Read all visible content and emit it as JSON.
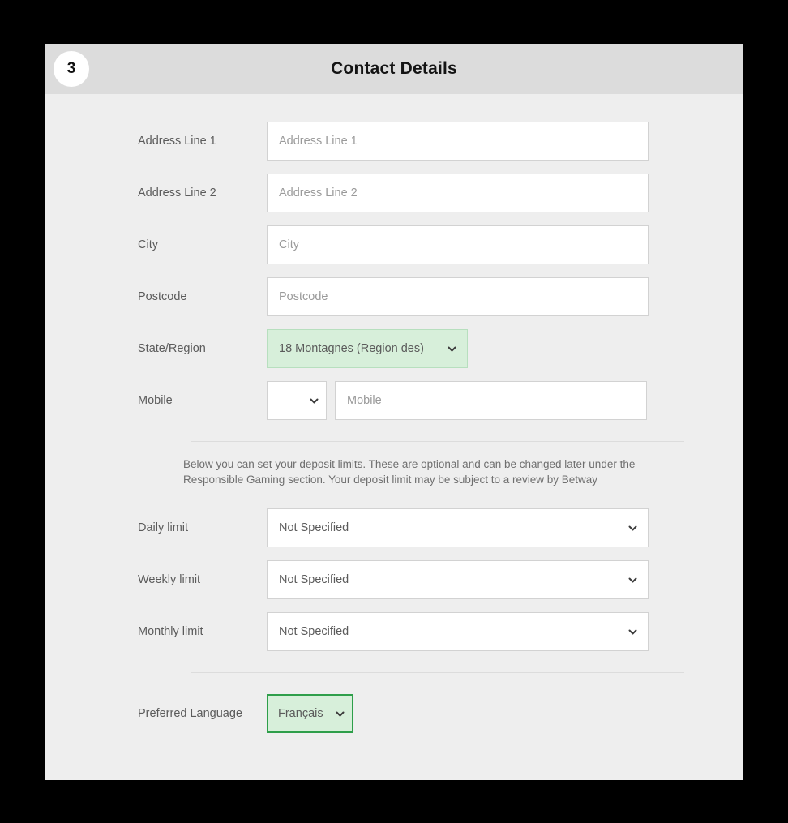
{
  "header": {
    "step_number": "3",
    "title": "Contact Details"
  },
  "form": {
    "fields": [
      {
        "label": "Address Line 1",
        "placeholder": "Address Line 1",
        "value": ""
      },
      {
        "label": "Address Line 2",
        "placeholder": "Address Line 2",
        "value": ""
      },
      {
        "label": "City",
        "placeholder": "City",
        "value": ""
      },
      {
        "label": "Postcode",
        "placeholder": "Postcode",
        "value": ""
      }
    ],
    "state_region": {
      "label": "State/Region",
      "value": "18 Montagnes (Region des)"
    },
    "mobile": {
      "label": "Mobile",
      "country_code_value": "",
      "placeholder": "Mobile",
      "value": ""
    }
  },
  "deposit_limits": {
    "note": "Below you can set your deposit limits. These are optional and can be changed later under the Responsible Gaming section. Your deposit limit may be subject to a review by Betway",
    "limits": [
      {
        "label": "Daily limit",
        "value": "Not Specified"
      },
      {
        "label": "Weekly limit",
        "value": "Not Specified"
      },
      {
        "label": "Monthly limit",
        "value": "Not Specified"
      }
    ]
  },
  "preferred_language": {
    "label": "Preferred Language",
    "value": "Français"
  },
  "colors": {
    "header_bar": "#dcdcdc",
    "page_background": "#eeeeee",
    "highlight_green_fill": "#d7efda",
    "highlight_green_border": "#2e9e4a",
    "input_border": "#d2d2d2"
  }
}
